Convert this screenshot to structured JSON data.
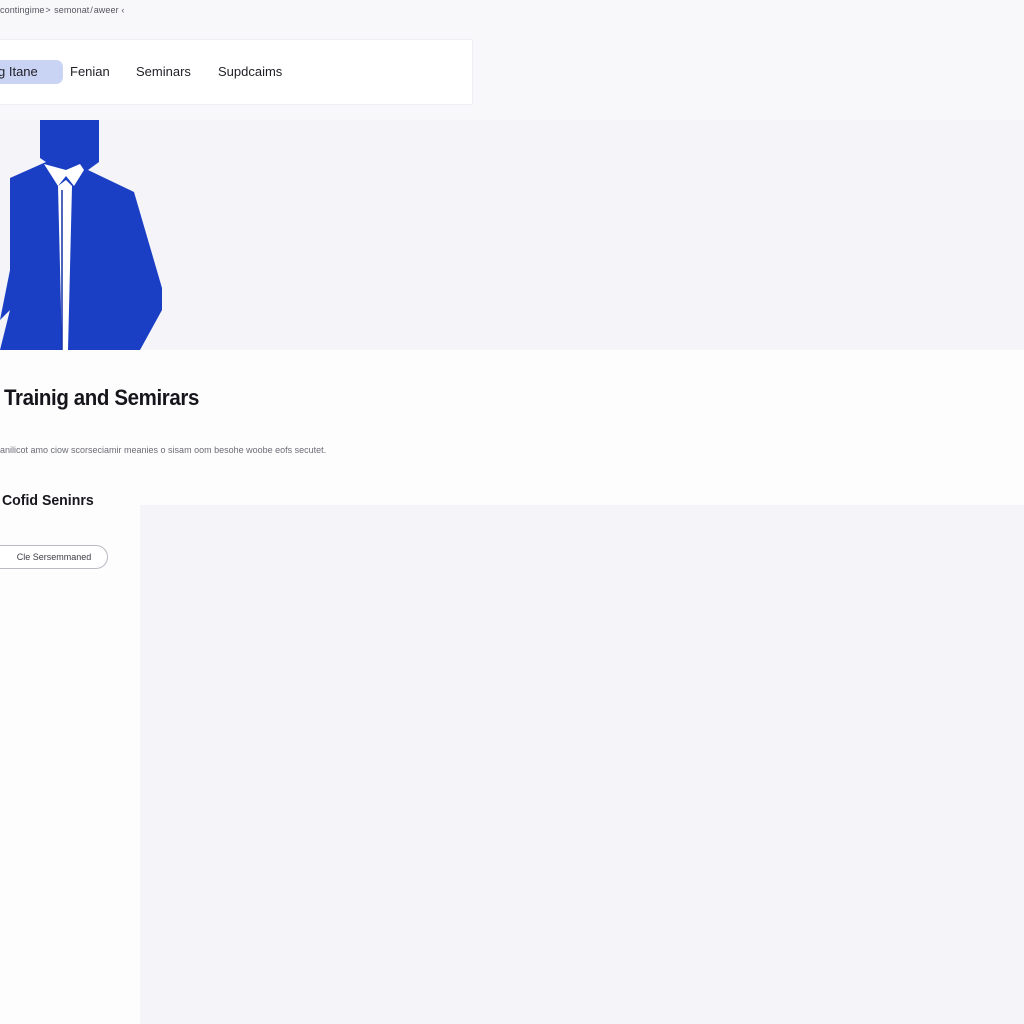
{
  "breadcrumb": "contingime >  semonat / aweer ‹",
  "tabs": [
    {
      "label": "g Itane",
      "active": true
    },
    {
      "label": "Fenian",
      "active": false
    },
    {
      "label": "Seminars",
      "active": false
    },
    {
      "label": "Supdcaims",
      "active": false
    }
  ],
  "hero": {
    "illustration_icon": "businessman-silhouette-icon",
    "brand_color": "#1a3fc4"
  },
  "main": {
    "title": "Trainig and Semirars",
    "description": "anilicot amo ciow scorseciamir meanies o sisam oom besohe woobe eofs secutet.",
    "section_heading": "Cofid Seninrs",
    "button_label": "Cle Sersemmaned"
  }
}
